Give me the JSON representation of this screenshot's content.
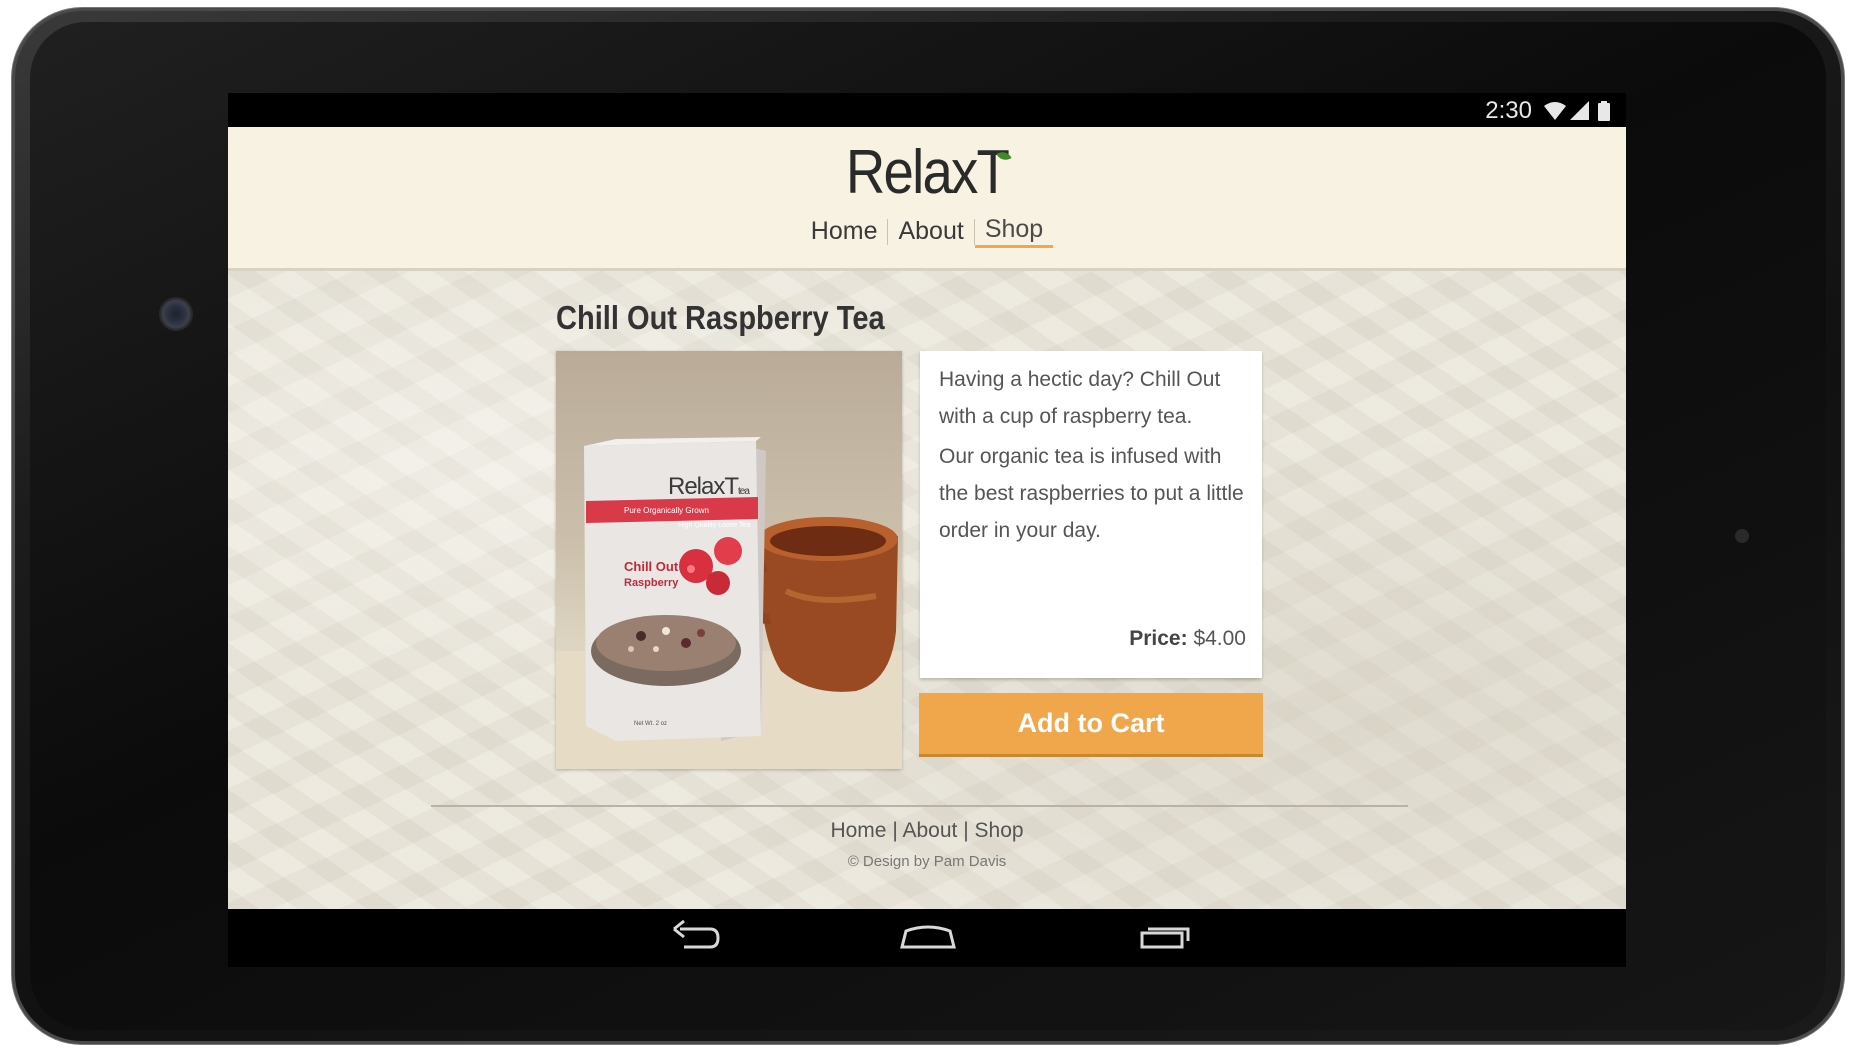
{
  "status_bar": {
    "time": "2:30",
    "icons": [
      "wifi-icon",
      "signal-icon",
      "battery-icon"
    ]
  },
  "header": {
    "logo": "RelaxT",
    "nav": [
      {
        "label": "Home",
        "active": false
      },
      {
        "label": "About",
        "active": false
      },
      {
        "label": "Shop",
        "active": true
      }
    ]
  },
  "product": {
    "title": "Chill Out Raspberry Tea",
    "image": {
      "brand": "RelaxT",
      "brand_suffix": "tea",
      "tagline_1": "Pure Organically Grown",
      "tagline_2": "High Quality Loose Tea",
      "name_line_1": "Chill Out",
      "name_line_2": "Raspberry",
      "net_wt": "Net Wt. 2 oz"
    },
    "description": [
      "Having a hectic day? Chill Out with a cup of raspberry tea.",
      "Our organic tea is infused with the best raspberries to put a little order in your day."
    ],
    "price_label": "Price:",
    "price_value": "$4.00",
    "add_to_cart": "Add to Cart"
  },
  "footer": {
    "links": [
      "Home",
      "About",
      "Shop"
    ],
    "separator": "|",
    "copyright": "© Design by Pam Davis"
  },
  "system_nav": {
    "buttons": [
      "back-icon",
      "home-icon",
      "recents-icon"
    ]
  },
  "colors": {
    "header_bg": "#f8f2e2",
    "accent": "#f0a74c",
    "page_bg": "#ebe7dc"
  }
}
